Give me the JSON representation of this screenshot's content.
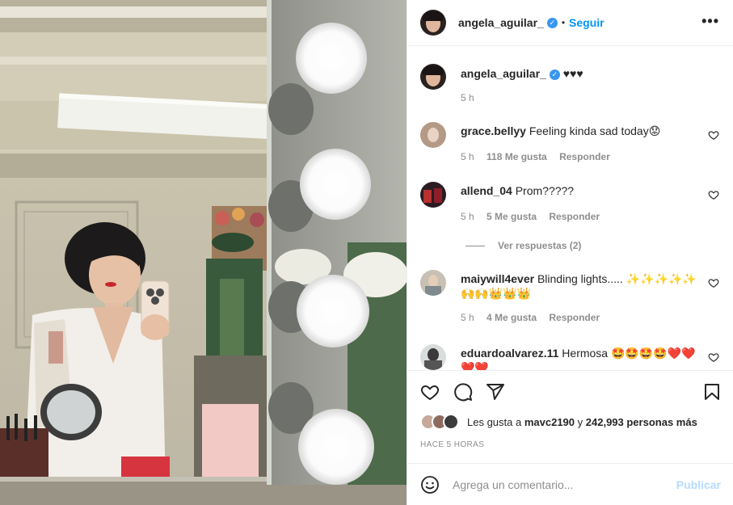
{
  "post": {
    "author": "angela_aguilar_",
    "follow_label": "Seguir",
    "caption": "♥♥♥",
    "caption_time": "5 h",
    "more_icon": "more-dots-icon",
    "verified_icon": "verified-badge-icon"
  },
  "comments": [
    {
      "user": "grace.bellyy",
      "text": "Feeling kinda sad today😟",
      "time": "5 h",
      "likes": "118 Me gusta",
      "reply": "Responder"
    },
    {
      "user": "allend_04",
      "text": "Prom?????",
      "time": "5 h",
      "likes": "5 Me gusta",
      "reply": "Responder",
      "view_replies": "Ver respuestas (2)"
    },
    {
      "user": "maiywill4ever",
      "text": "Blinding lights..... ✨✨✨✨✨ 🙌🙌👑👑👑",
      "time": "5 h",
      "likes": "4 Me gusta",
      "reply": "Responder"
    },
    {
      "user": "eduardoalvarez.11",
      "text": "Hermosa 🤩🤩🤩🤩❤️❤️ ❤️❤️",
      "time": "",
      "likes": "",
      "reply": ""
    }
  ],
  "actions": {
    "like_icon": "heart-icon",
    "comment_icon": "comment-icon",
    "share_icon": "send-icon",
    "save_icon": "bookmark-icon"
  },
  "likes_summary": {
    "prefix": "Les gusta a",
    "first_user": "mavc2190",
    "connector": "y",
    "others": "242,993 personas más"
  },
  "timestamp": "HACE 5 HORAS",
  "composer": {
    "placeholder": "Agrega un comentario...",
    "publish_label": "Publicar",
    "emoji_icon": "emoji-smile-icon"
  },
  "colors": {
    "accent": "#0095f6",
    "verified": "#3897f0",
    "muted": "#8e8e8e",
    "publish_disabled": "#b3dbff"
  }
}
